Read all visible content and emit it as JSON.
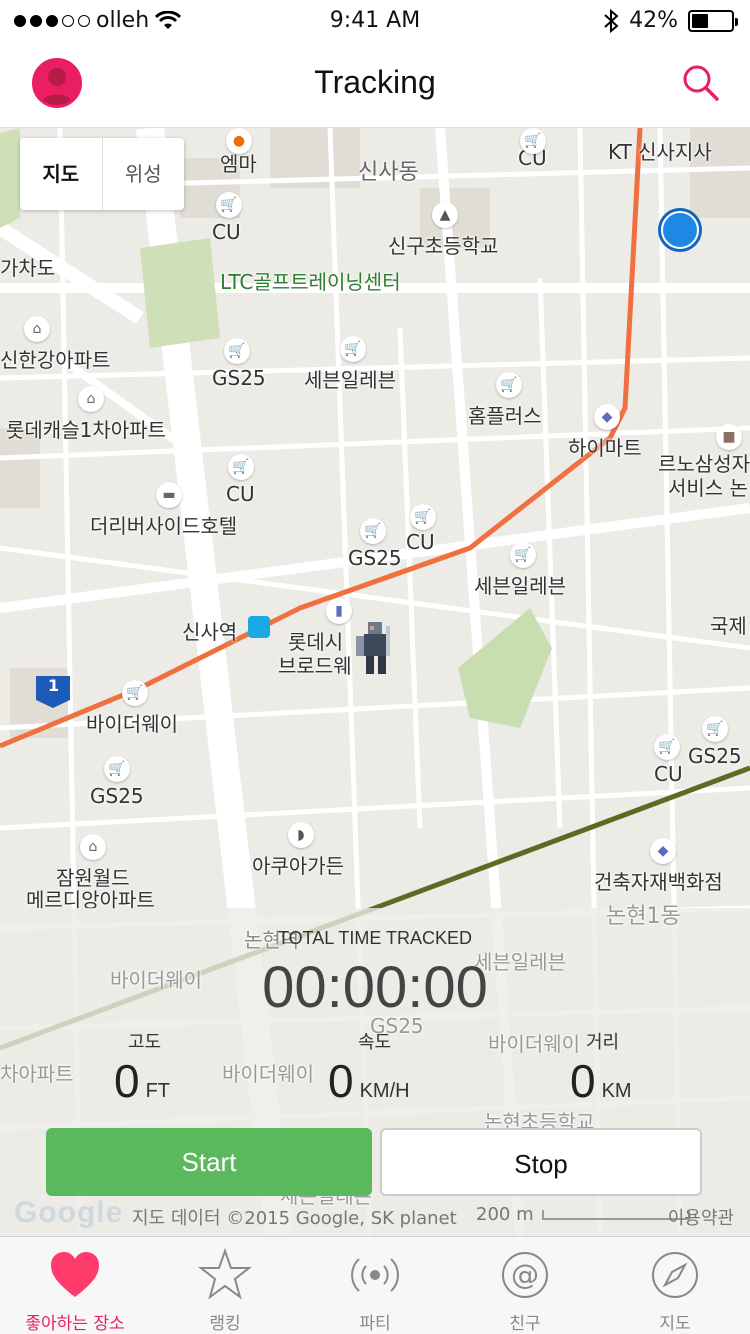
{
  "status_bar": {
    "carrier": "olleh",
    "time": "9:41 AM",
    "battery": "42%"
  },
  "navbar": {
    "title": "Tracking"
  },
  "map": {
    "toggle": {
      "map": "지도",
      "satellite": "위성"
    },
    "labels": {
      "emma": "엠마",
      "sinsa_dong": "신사동",
      "cu1": "CU",
      "kt": "KT 신사지사",
      "cu2": "CU",
      "shingu_school": "신구초등학교",
      "ltc_golf": "LTC골프트레이닝센터",
      "gacha": "가차도",
      "shingang_apt": "신한강아파트",
      "gs25_1": "GS25",
      "seven1": "세븐일레븐",
      "homeplus": "홈플러스",
      "lotte_castle": "롯데캐슬1차아파트",
      "haimart": "하이마트",
      "renault1": "르노삼성자",
      "renault2": "서비스 논",
      "cu3": "CU",
      "river_hotel": "더리버사이드호텔",
      "gs25_2": "GS25",
      "cu4": "CU",
      "seven2": "세븐일레븐",
      "sinsa_station": "신사역",
      "lotte_sinema1": "롯데시",
      "lotte_sinema2": "브로드웨",
      "gukje": "국제",
      "byder1": "바이더웨이",
      "gs25_3": "GS25",
      "cu5": "CU",
      "gs25_4": "GS25",
      "jamwon1": "잠원월드",
      "jamwon2": "메르디앙아파트",
      "aqua": "아쿠아가든",
      "building": "건축자재백화점",
      "route_no": "1",
      "nonhyeon1": "논현1동",
      "nonhyeon_st": "논현역",
      "byder2": "바이더웨이",
      "seven3": "세븐일레븐",
      "gs25_5": "GS25",
      "byder3": "바이더웨이",
      "apt_frag": "차아파트",
      "byder4": "바이더웨이",
      "nonhyeon_school": "논현초등학교",
      "seven4": "세븐일레븐"
    }
  },
  "tracking": {
    "total_label": "TOTAL TIME TRACKED",
    "timer": "00:00:00",
    "altitude": {
      "label": "고도",
      "value": "0",
      "unit": "FT"
    },
    "speed": {
      "label": "속도",
      "value": "0",
      "unit": "KM/H"
    },
    "distance": {
      "label": "거리",
      "value": "0",
      "unit": "KM"
    },
    "start": "Start",
    "stop": "Stop",
    "attribution": "지도 데이터 ©2015 Google, SK planet",
    "scale": "200 m",
    "terms": "이용약관",
    "google": "Google"
  },
  "tabs": [
    {
      "label": "좋아하는 장소",
      "icon": "heart-icon",
      "active": true
    },
    {
      "label": "랭킹",
      "icon": "star-icon"
    },
    {
      "label": "파티",
      "icon": "broadcast-icon"
    },
    {
      "label": "친구",
      "icon": "at-icon"
    },
    {
      "label": "지도",
      "icon": "compass-icon"
    }
  ],
  "colors": {
    "accent": "#e91e63",
    "start_button": "#5cb85c",
    "metro_line": "#f07040",
    "rail_line": "#5b6b22",
    "park": "#c8deb0"
  }
}
